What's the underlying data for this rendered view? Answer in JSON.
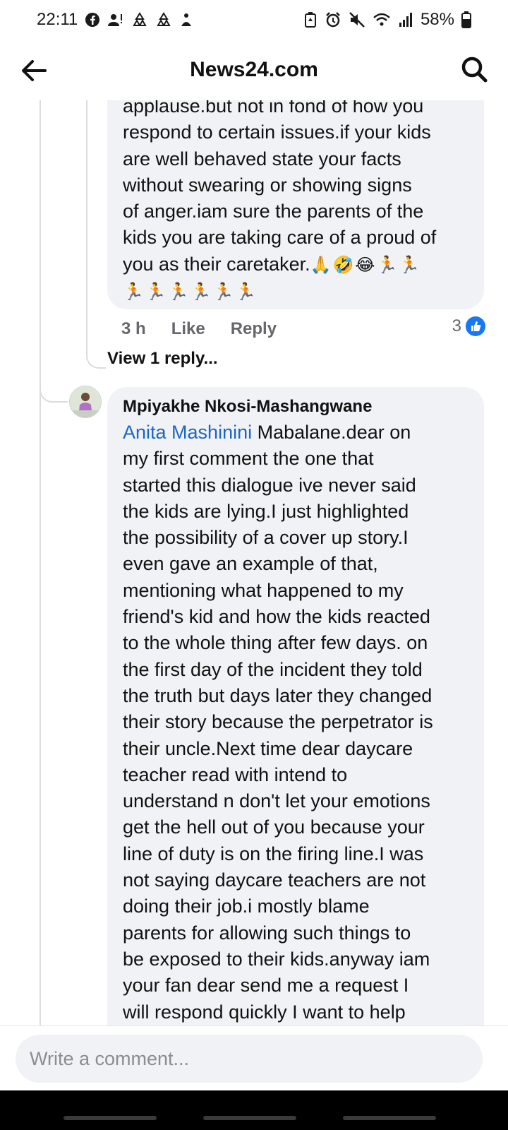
{
  "status_bar": {
    "time": "22:11",
    "battery": "58%",
    "left_icons": [
      "facebook-icon",
      "user-alert-icon",
      "recycle-icon",
      "recycle-icon",
      "wellbeing-icon"
    ],
    "right_icons": [
      "saver-icon",
      "alarm-icon",
      "mute-icon",
      "wifi-icon",
      "signal-icon",
      "battery-icon"
    ]
  },
  "header": {
    "title": "News24.com"
  },
  "comment1": {
    "text": "applause.but not in fond of how you\nrespond to certain issues.if your kids\nare well behaved state your facts\nwithout swearing or showing signs\nof anger.iam sure the parents of the\nkids you are taking care of a proud of\nyou as their caretaker.",
    "emoji_line1": "🙏🤣😂🏃🏃",
    "emoji_line2": "🏃🏃🏃🏃🏃🏃",
    "time": "3 h",
    "like_label": "Like",
    "reply_label": "Reply",
    "reaction_count": "3"
  },
  "view_replies": "View 1 reply...",
  "comment2": {
    "author": "Mpiyakhe Nkosi-Mashangwane",
    "mention": "Anita Mashinini",
    "text_first": " Mabalane.dear on",
    "text": "my first comment the one that\nstarted this dialogue ive never said\nthe kids are lying.I just highlighted\nthe possibility of a cover up story.I\neven gave an example of that,\nmentioning what happened to my\nfriend's kid and how the kids reacted\nto the whole thing after few days. on\nthe first day of the incident they told\nthe truth but days later they changed\ntheir story because the perpetrator is\ntheir uncle.Next time dear daycare\nteacher read with intend to\nunderstand n don't let your emotions\nget the hell out of you because your\nline of duty is on the firing line.I was\nnot saying daycare teachers are not\ndoing their job.i mostly blame\nparents for allowing such things to\nbe exposed to their kids.anyway iam\nyour fan dear send me a request I\nwill respond quickly I want to help"
  },
  "composer": {
    "placeholder": "Write a comment..."
  },
  "colors": {
    "bubble": "#f0f2f5",
    "mention": "#1a66c4",
    "like_blue": "#1877f2",
    "meta_grey": "#65676b"
  }
}
